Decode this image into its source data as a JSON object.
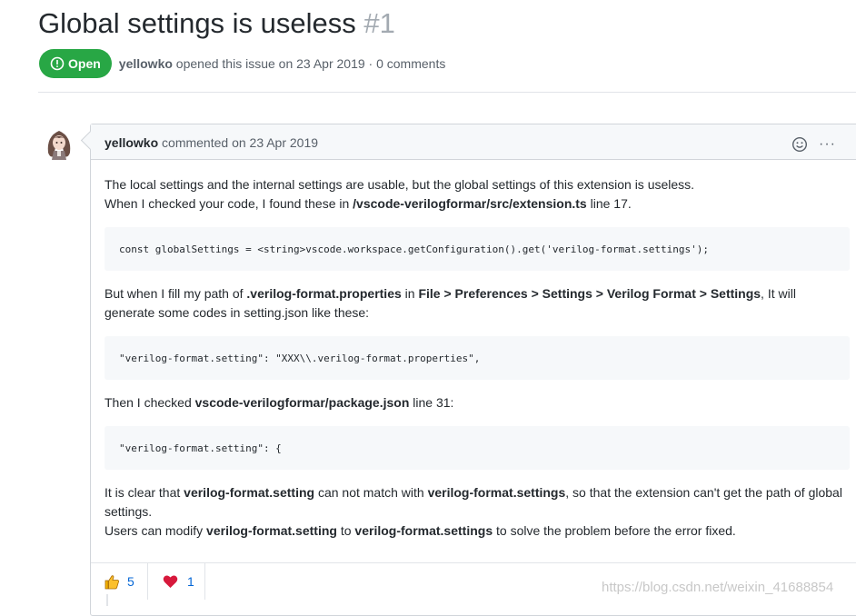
{
  "issue": {
    "title": "Global settings is useless",
    "number": "#1",
    "state_label": "Open",
    "state_color": "#28a745",
    "author": "yellowko",
    "meta_text": " opened this issue on 23 Apr 2019 · 0 comments"
  },
  "comment": {
    "author": "yellowko",
    "meta": " commented on 23 Apr 2019",
    "header_icons": [
      "smiley-icon",
      "more-options-icon"
    ],
    "more_label": "···",
    "para1_line1": "The local settings and the internal settings are usable, but the global settings of this extension is useless.",
    "para1_line2_a": "When I checked your code, I found these in ",
    "para1_line2_b": "/vscode-verilogformar/src/extension.ts",
    "para1_line2_c": " line 17.",
    "code1": "const globalSettings = <string>vscode.workspace.getConfiguration().get('verilog-format.settings');",
    "para2_a": "But when I fill my path of ",
    "para2_b": ".verilog-format.properties",
    "para2_c": " in ",
    "para2_d": "File > Preferences > Settings > Verilog Format > Settings",
    "para2_e": ", It will generate some codes in setting.json like these:",
    "code2": "\"verilog-format.setting\": \"XXX\\\\.verilog-format.properties\",",
    "para3_a": "Then I checked ",
    "para3_b": "vscode-verilogformar/package.json",
    "para3_c": " line 31:",
    "code3": "\"verilog-format.setting\": {",
    "para4_a": "It is clear that ",
    "para4_b": "verilog-format.setting",
    "para4_c": " can not match with ",
    "para4_d": "verilog-format.settings",
    "para4_e": ", so that the extension can't get the path of global settings.",
    "para5_a": "Users can modify ",
    "para5_b": "verilog-format.setting",
    "para5_c": " to ",
    "para5_d": "verilog-format.settings",
    "para5_e": " to solve the problem before the error fixed."
  },
  "reactions": [
    {
      "icon": "thumbs-up-icon",
      "count": "5"
    },
    {
      "icon": "heart-icon",
      "count": "1"
    }
  ],
  "watermark": "https://blog.csdn.net/weixin_41688854"
}
